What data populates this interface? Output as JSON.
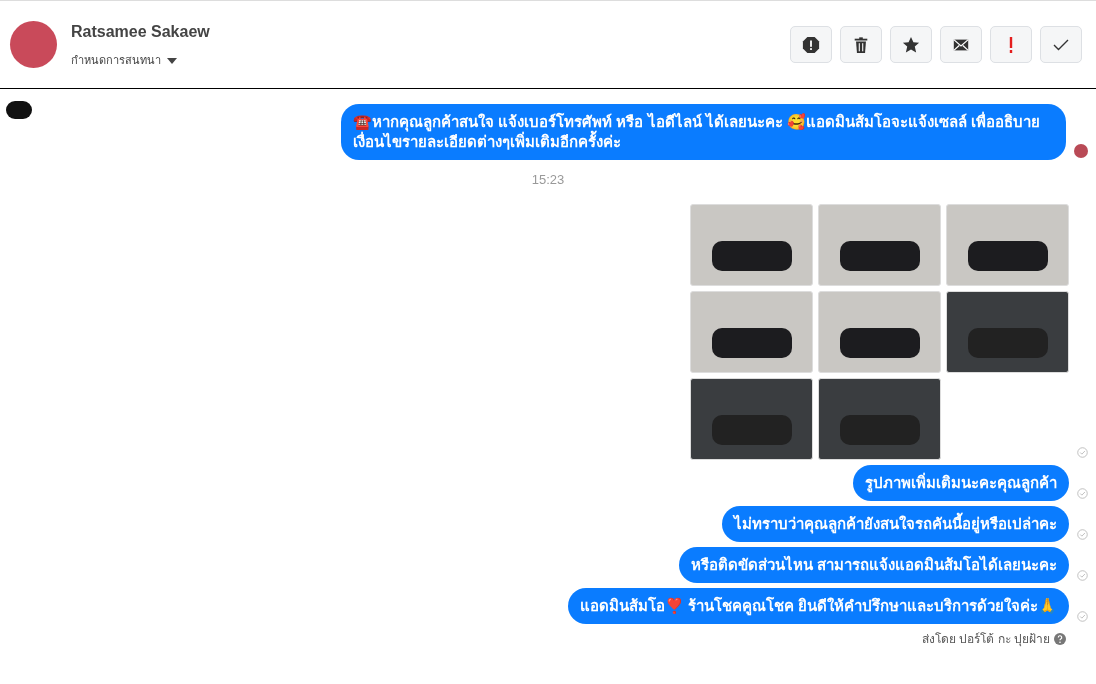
{
  "header": {
    "name": "Ratsamee Sakaew",
    "assign_label": "กำหนดการสนทนา"
  },
  "actions": [
    {
      "kind": "spam"
    },
    {
      "kind": "delete"
    },
    {
      "kind": "star"
    },
    {
      "kind": "unread"
    },
    {
      "kind": "important"
    },
    {
      "kind": "done"
    }
  ],
  "messages": [
    {
      "kind": "text",
      "text": "☎️หากคุณลูกค้าสนใจ แจ้งเบอร์โทรศัพท์ หรือ ไอดีไลน์  ได้เลยนะคะ 🥰แอดมินส้มโอจะแจ้งเซลล์   เพื่ออธิบายเงื่อนไขรายละเอียดต่างๆเพิ่มเติมอีกครั้งค่ะ",
      "seen": true
    },
    {
      "kind": "time",
      "text": "15:23"
    },
    {
      "kind": "images",
      "seen": false,
      "images": [
        {
          "dark": false
        },
        {
          "dark": false
        },
        {
          "dark": false
        },
        {
          "dark": false
        },
        {
          "dark": false
        },
        {
          "dark": true
        },
        {
          "dark": true
        },
        {
          "dark": true
        }
      ]
    },
    {
      "kind": "text",
      "text": "รูปภาพเพิ่มเติมนะคะคุณลูกค้า",
      "seen": false
    },
    {
      "kind": "text",
      "text": "ไม่ทราบว่าคุณลูกค้ายังสนใจรถคันนี้อยู่หรือเปล่าคะ",
      "seen": false
    },
    {
      "kind": "text",
      "text": "หรือติดขัดส่วนไหน สามารถแจ้งแอดมินส้มโอได้เลยนะคะ",
      "seen": false
    },
    {
      "kind": "text",
      "text": "แอดมินส้มโอ❣️ ร้านโชคคูณโชค ยินดีให้คำปรึกษาและบริการด้วยใจค่ะ🙏",
      "seen": false
    }
  ],
  "sent_by": "ส่งโดย ปอร์โต้ กะ ปุยฝ้าย"
}
